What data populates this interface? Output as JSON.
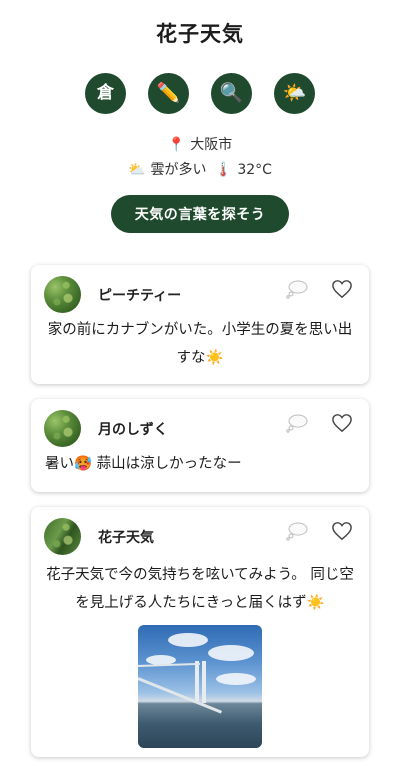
{
  "app": {
    "title": "花子天気"
  },
  "toolbar": [
    {
      "name": "warehouse-button",
      "glyph": "倉"
    },
    {
      "name": "pencil-button",
      "glyph": "✏️"
    },
    {
      "name": "search-button",
      "glyph": "🔍"
    },
    {
      "name": "weather-button",
      "glyph": "🌤️"
    }
  ],
  "location": {
    "pin": "📍",
    "city": "大阪市"
  },
  "weather": {
    "icon": "⛅",
    "condition": "雲が多い",
    "temp_icon": "🌡️",
    "temperature": "32°C"
  },
  "cta_label": "天気の言葉を探そう",
  "posts": [
    {
      "username": "ピーチティー",
      "text": "家の前にカナブンがいた。小学生の夏を思い出すな☀️"
    },
    {
      "username": "月のしずく",
      "text": "暑い🥵 蒜山は涼しかったなー"
    },
    {
      "username": "花子天気",
      "text": "花子天気で今の気持ちを呟いてみよう。 同じ空を見上げる人たちにきっと届くはず☀️"
    }
  ],
  "colors": {
    "brand": "#1f4a2e",
    "card_bg": "#ffffff"
  }
}
